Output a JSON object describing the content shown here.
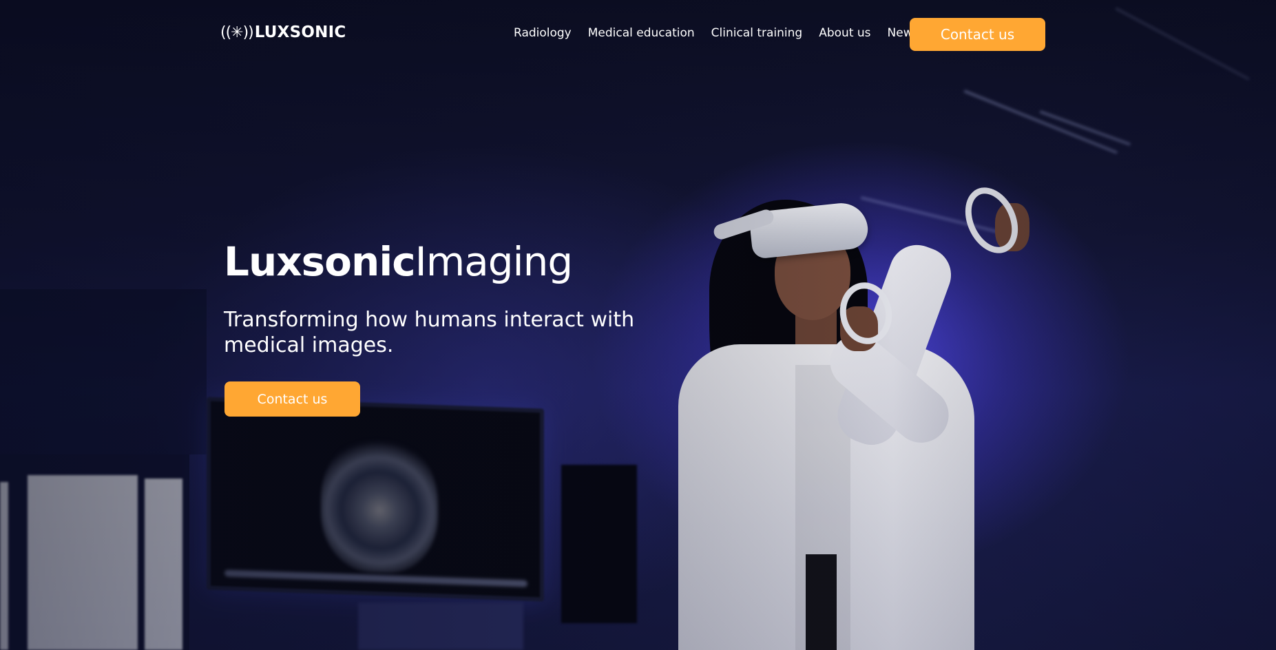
{
  "brand": {
    "logo_mark": "((✳))",
    "logo_text": "LUXSONIC"
  },
  "nav": {
    "items": [
      {
        "label": "Radiology"
      },
      {
        "label": "Medical education"
      },
      {
        "label": "Clinical training"
      },
      {
        "label": "About us"
      },
      {
        "label": "News"
      }
    ],
    "cta_label": "Contact us"
  },
  "hero": {
    "title_strong": "Luxsonic",
    "title_light": "Imaging",
    "subtitle": "Transforming how humans interact with medical images.",
    "cta_label": "Contact us",
    "image_description_icon": "vr-headset-photo"
  },
  "colors": {
    "accent": "#ffa733",
    "text": "#ffffff",
    "background": "#0b0d24",
    "glow": "#584eff"
  }
}
